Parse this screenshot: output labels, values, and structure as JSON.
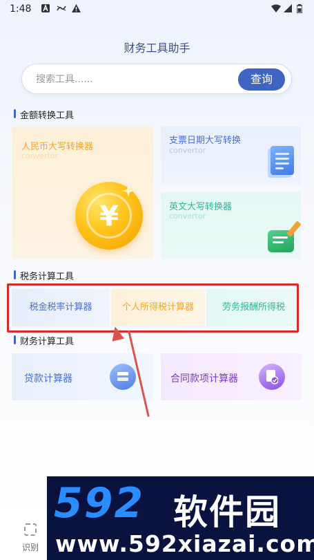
{
  "status_bar": {
    "time": "1:48",
    "icons_left": [
      "notification-a-icon",
      "link-icon",
      "warning-icon"
    ],
    "icons_right": [
      "wifi-icon",
      "signal-icon",
      "battery-icon"
    ]
  },
  "app": {
    "title": "财务工具助手"
  },
  "search": {
    "placeholder": "搜索工具......",
    "button_label": "查询"
  },
  "sections": {
    "amount": {
      "title": "金额转换工具",
      "cards": [
        {
          "title": "人民币大写转换器",
          "subtitle": "convertor",
          "icon": "yuan-coin-icon"
        },
        {
          "title": "支票日期大写转换",
          "subtitle": "convertor",
          "icon": "document-icon"
        },
        {
          "title": "英文大写转换器",
          "subtitle": "convertor",
          "icon": "chat-pencil-icon"
        }
      ]
    },
    "tax": {
      "title": "税务计算工具",
      "tiles": [
        {
          "title": "税金税率计算器"
        },
        {
          "title": "个人所得税计算器"
        },
        {
          "title": "劳务报酬所得税"
        }
      ]
    },
    "finance": {
      "title": "财务计算工具",
      "cards": [
        {
          "title": "贷款计算器",
          "icon": "loan-calculator-icon"
        },
        {
          "title": "合同款项计算器",
          "icon": "contract-icon"
        }
      ]
    }
  },
  "bottom_nav": {
    "scan_label": "识别"
  },
  "watermark": {
    "digits": "592",
    "brand": "软件园",
    "url": "www.592xiazai.com"
  },
  "colors": {
    "accent": "#3f64c2",
    "highlight_box": "#d62b2b",
    "annotation_arrow": "#d9534f",
    "orange_text": "#f5a623",
    "blue_text": "#4a6fd1",
    "green_text": "#2fb89a",
    "purple_text": "#7a3bc2"
  }
}
